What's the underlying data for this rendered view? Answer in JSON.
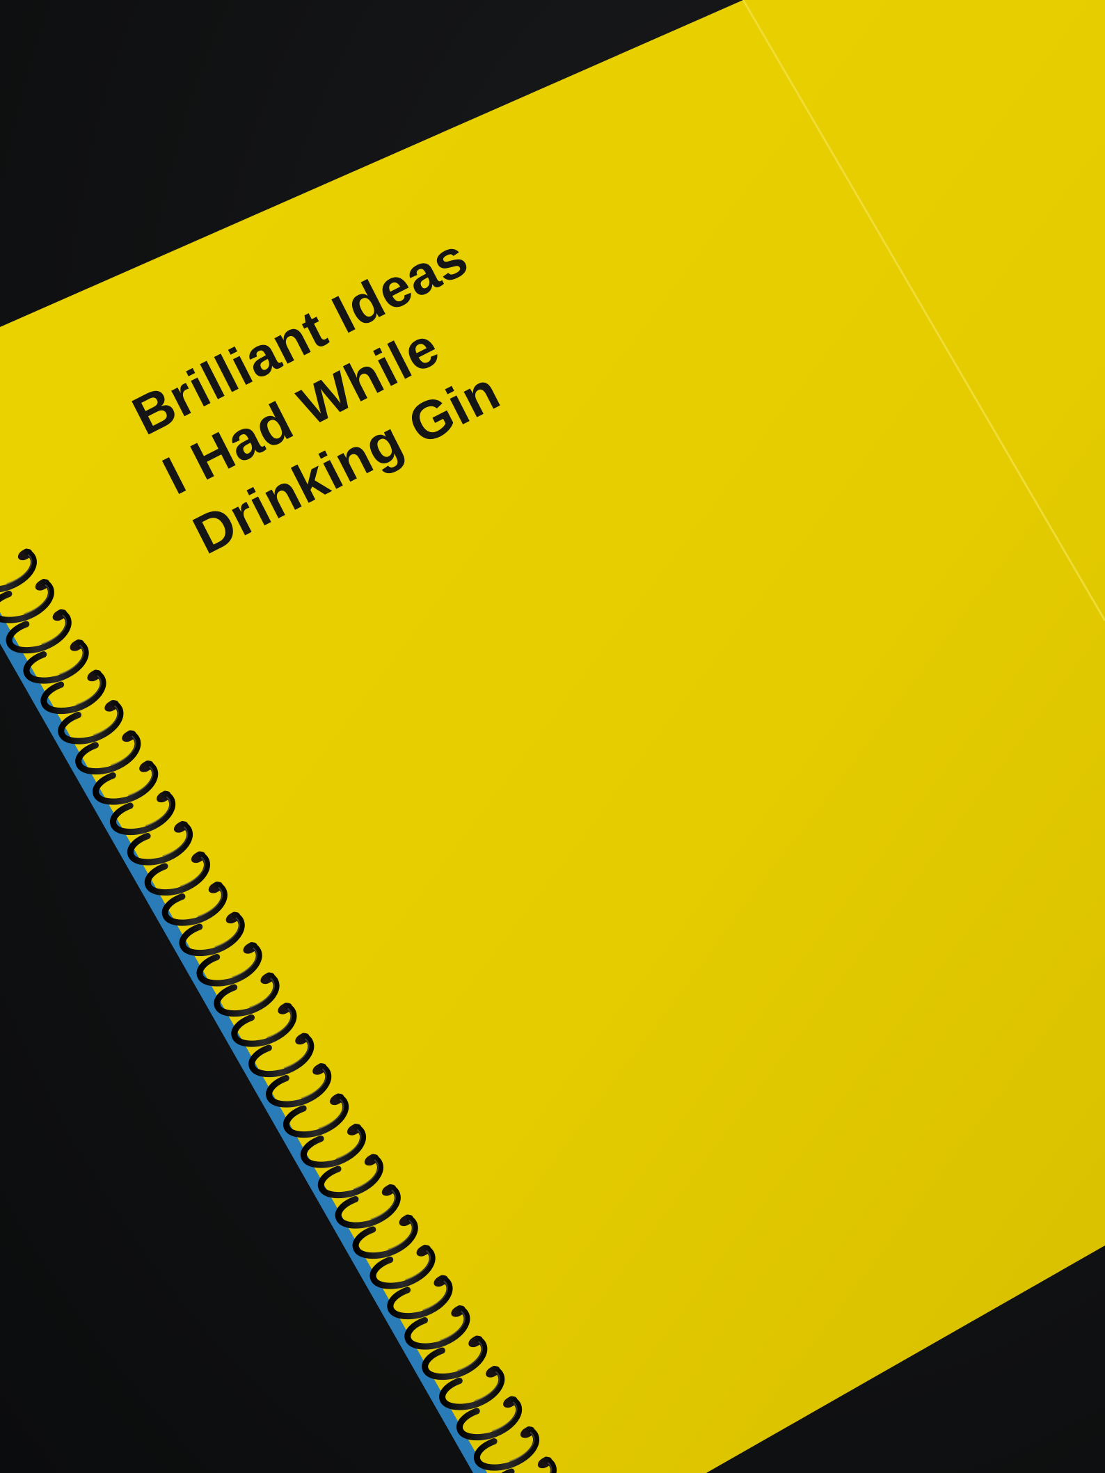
{
  "cover": {
    "title_lines": [
      "Brilliant Ideas",
      "I Had While",
      "Drinking Gin"
    ]
  },
  "colors": {
    "background": "#111213",
    "cover_yellow": "#e6cf00",
    "coil": "#0a0a0a",
    "page_edge_blue": "#2f8fd6",
    "title_text": "#151515"
  },
  "icons": [
    "spiral-coil"
  ]
}
